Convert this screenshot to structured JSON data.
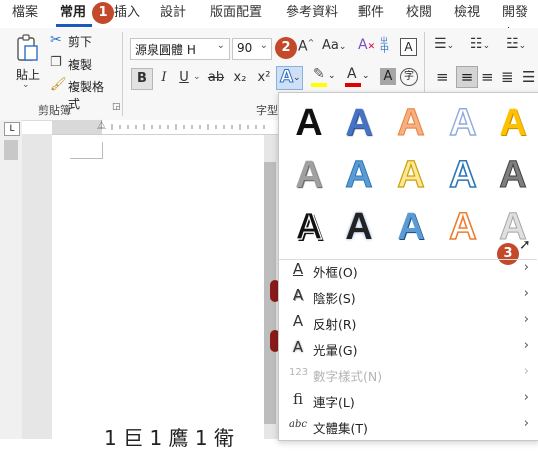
{
  "tabs": [
    {
      "label": "檔案"
    },
    {
      "label": "常用"
    },
    {
      "label": "插入"
    },
    {
      "label": "設計"
    },
    {
      "label": "版面配置"
    },
    {
      "label": "參考資料"
    },
    {
      "label": "郵件"
    },
    {
      "label": "校閱"
    },
    {
      "label": "檢視"
    },
    {
      "label": "開發人"
    }
  ],
  "badges": {
    "one": "1",
    "two": "2",
    "three": "3"
  },
  "clipboard": {
    "paste": "貼上",
    "cut": "剪下",
    "copy": "複製",
    "format_painter": "複製格式",
    "group_label": "剪貼簿"
  },
  "font": {
    "name": "源泉圓體 H",
    "size": "90",
    "case_label": "Aa",
    "phonetic": "中",
    "group_label": "字型"
  },
  "format_buttons": {
    "bold": "B",
    "italic": "I",
    "underline": "U",
    "strike": "ab",
    "subscript": "x₂",
    "superscript": "x²",
    "text_effects": "A",
    "font_color": "A",
    "char_shading": "A",
    "enclose": "字"
  },
  "gallery": {
    "letter": "A",
    "colors": {
      "blue": "#4472c4",
      "orange": "#ed7d31",
      "gold": "#ffc000",
      "grey": "#8c8c8c",
      "black": "#111111"
    }
  },
  "menu": [
    {
      "label": "外框(O)",
      "icon": "outline-icon",
      "enabled": true
    },
    {
      "label": "陰影(S)",
      "icon": "shadow-icon",
      "enabled": true
    },
    {
      "label": "反射(R)",
      "icon": "reflection-icon",
      "enabled": true
    },
    {
      "label": "光暈(G)",
      "icon": "glow-icon",
      "enabled": true
    },
    {
      "label": "數字樣式(N)",
      "icon": "number-style-icon",
      "enabled": false
    },
    {
      "label": "連字(L)",
      "icon": "ligature-icon",
      "enabled": true
    },
    {
      "label": "文體集(T)",
      "icon": "stylistic-set-icon",
      "enabled": true
    }
  ],
  "menu_icons": {
    "outline": "A",
    "shadow": "A",
    "reflection": "A",
    "glow": "A",
    "number": "123",
    "ligature": "fi",
    "stylistic": "abc"
  },
  "document": {
    "text": "1 巨 1 鷹 1 衛"
  }
}
